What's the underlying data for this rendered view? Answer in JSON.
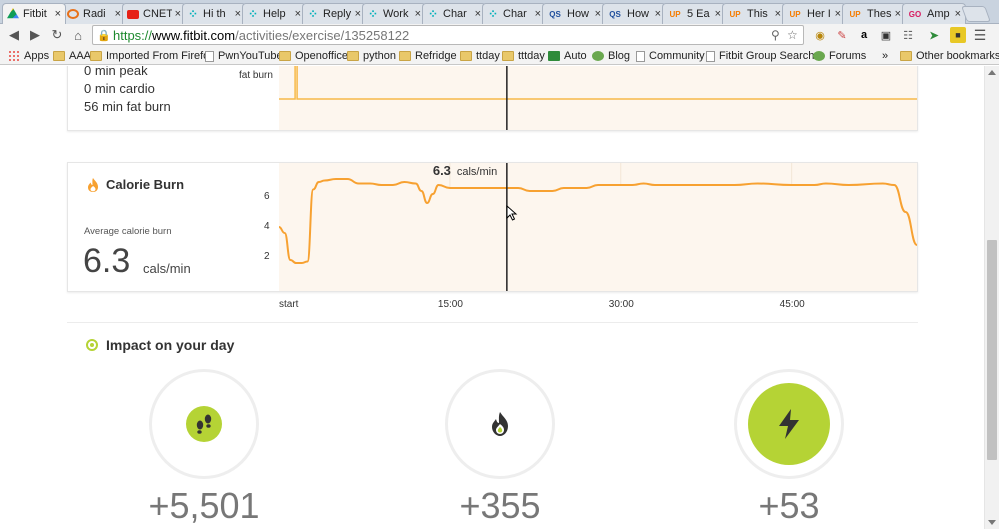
{
  "browser": {
    "tabs": [
      {
        "title": "Fitbit",
        "icon": "drive-icon",
        "color": "#f4b400"
      },
      {
        "title": "Radi",
        "icon": "radio-icon",
        "color": "#e8711a"
      },
      {
        "title": "CNET",
        "icon": "youtube-icon",
        "color": "#e62117"
      },
      {
        "title": "Hi th",
        "icon": "fitbit-dots-icon",
        "color": "#00b0b9"
      },
      {
        "title": "Help",
        "icon": "fitbit-dots-icon",
        "color": "#00b0b9"
      },
      {
        "title": "Reply",
        "icon": "fitbit-dots-icon",
        "color": "#00b0b9"
      },
      {
        "title": "Work",
        "icon": "fitbit-dots-icon",
        "color": "#00b0b9"
      },
      {
        "title": "Char",
        "icon": "fitbit-dots-icon",
        "color": "#00b0b9"
      },
      {
        "title": "Char",
        "icon": "fitbit-dots-icon",
        "color": "#00b0b9"
      },
      {
        "title": "How",
        "icon": "qs-icon",
        "color": "#1f4e9b",
        "badge": "QS"
      },
      {
        "title": "How",
        "icon": "qs-icon",
        "color": "#1f4e9b",
        "badge": "QS"
      },
      {
        "title": "5 Ea",
        "icon": "up-icon",
        "color": "#f57c00",
        "badge": "UP"
      },
      {
        "title": "This",
        "icon": "up-icon",
        "color": "#f57c00",
        "badge": "UP"
      },
      {
        "title": "Her I",
        "icon": "up-icon",
        "color": "#f57c00",
        "badge": "UP"
      },
      {
        "title": "Thes",
        "icon": "up-icon",
        "color": "#f57c00",
        "badge": "UP"
      },
      {
        "title": "Amp",
        "icon": "go-icon",
        "color": "#d81b60",
        "badge": "GO"
      }
    ],
    "url": {
      "scheme": "https://",
      "host": "www.fitbit.com",
      "path": "/activities/exercise/135258122"
    },
    "bookmarks": [
      {
        "label": "Apps",
        "type": "apps"
      },
      {
        "label": "AAA",
        "type": "folder"
      },
      {
        "label": "Imported From Firefo",
        "type": "folder"
      },
      {
        "label": "PwnYouTube",
        "type": "page"
      },
      {
        "label": "Openoffice",
        "type": "folder"
      },
      {
        "label": "python",
        "type": "folder"
      },
      {
        "label": "Refridge",
        "type": "folder"
      },
      {
        "label": "ttday",
        "type": "folder"
      },
      {
        "label": "tttday",
        "type": "folder"
      },
      {
        "label": "Auto",
        "type": "sheet"
      },
      {
        "label": "Blog",
        "type": "green"
      },
      {
        "label": "Community",
        "type": "page"
      },
      {
        "label": "Fitbit Group Search -",
        "type": "page"
      },
      {
        "label": "Forums",
        "type": "green"
      }
    ],
    "overflow": "»",
    "other_bookmarks": "Other bookmarks"
  },
  "heart_zones": {
    "peak": "0 min peak",
    "cardio": "0 min cardio",
    "fat_burn": "56 min fat burn",
    "chart_label": "fat burn"
  },
  "calorie_burn": {
    "title": "Calorie Burn",
    "avg_label": "Average calorie burn",
    "avg_value": "6.3",
    "avg_unit": "cals/min",
    "tooltip_value": "6.3",
    "tooltip_unit": "cals/min"
  },
  "chart_data": {
    "type": "line",
    "ylabel": "",
    "yticks": [
      "6",
      "4",
      "2"
    ],
    "xticks": [
      "start",
      "15:00",
      "30:00",
      "45:00"
    ],
    "ylim": [
      0,
      8
    ],
    "xlim": [
      0,
      56
    ],
    "cursor_x": 20,
    "x": [
      0,
      0.5,
      1,
      1.5,
      2,
      2.5,
      3,
      3.5,
      4,
      5,
      6,
      7,
      8,
      9,
      10,
      11,
      12,
      12.5,
      13,
      13.5,
      14,
      15,
      16,
      17,
      18,
      20,
      21,
      22,
      23,
      24,
      25,
      26,
      27,
      28,
      30,
      31,
      32,
      33,
      35,
      37,
      40,
      42,
      45,
      47,
      48,
      50,
      53,
      54,
      55,
      56
    ],
    "values": [
      4.0,
      3.6,
      1.8,
      1.6,
      1.6,
      1.7,
      6.5,
      7.0,
      7.1,
      7.2,
      7.2,
      6.9,
      6.9,
      6.8,
      6.8,
      7.0,
      6.9,
      6.4,
      5.6,
      6.2,
      6.8,
      6.6,
      6.6,
      6.6,
      6.6,
      6.6,
      6.6,
      6.4,
      6.4,
      6.4,
      6.6,
      6.6,
      6.6,
      6.8,
      6.8,
      6.8,
      6.9,
      6.8,
      6.8,
      6.8,
      6.8,
      6.9,
      6.8,
      6.8,
      6.9,
      6.8,
      6.9,
      6.8,
      5.0,
      2.8
    ],
    "color": "#f7a131",
    "fill": "#fdf6ee"
  },
  "heart_chart": {
    "baseline": 1,
    "spike_at": 1.5,
    "color": "#f7b948"
  },
  "impact": {
    "title": "Impact on your day",
    "items": [
      {
        "value": "+5,501",
        "icon": "steps-icon",
        "ring_color": "#eeeeee",
        "accent": "#b5d335"
      },
      {
        "value": "+355",
        "icon": "flame-icon",
        "ring_color": "#eeeeee",
        "accent": "#b5d335"
      },
      {
        "value": "+53",
        "icon": "lightning-icon",
        "ring_color": "#eeeeee",
        "accent": "#b5d335"
      }
    ]
  }
}
